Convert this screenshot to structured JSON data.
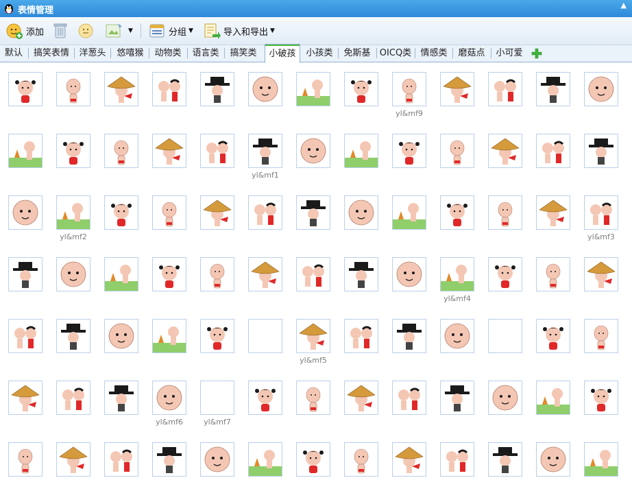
{
  "window": {
    "title": "表情管理",
    "maximize_glyph": "▲"
  },
  "toolbar": {
    "add_label": "添加",
    "group_label": "分组",
    "import_export_label": "导入和导出"
  },
  "tabs": [
    "默认",
    "搞笑表情",
    "洋葱头",
    "悠嘻猴",
    "动物类",
    "语言类",
    "搞笑类",
    "小破孩",
    "小孩类",
    "免斯基",
    "OICQ类",
    "情感类",
    "磨菇点",
    "小可爱"
  ],
  "active_tab": "小破孩",
  "emoticons": {
    "rows": 7,
    "cols": 13,
    "labels": [
      {
        "row": 0,
        "col": 8,
        "text": "yl&mf9"
      },
      {
        "row": 1,
        "col": 5,
        "text": "yl&mf1"
      },
      {
        "row": 2,
        "col": 1,
        "text": "yl&mf2"
      },
      {
        "row": 2,
        "col": 12,
        "text": "yl&mf3"
      },
      {
        "row": 3,
        "col": 9,
        "text": "yl&mf4"
      },
      {
        "row": 4,
        "col": 6,
        "text": "yl&mf5"
      },
      {
        "row": 5,
        "col": 3,
        "text": "yl&mf6"
      },
      {
        "row": 5,
        "col": 4,
        "text": "yl&mf7"
      }
    ]
  },
  "colors": {
    "titlebar": "#2e8ad8",
    "active_tab_accent": "#4fb83c",
    "cell_border": "#b9d0ea",
    "label_text": "#7d7d7d"
  }
}
